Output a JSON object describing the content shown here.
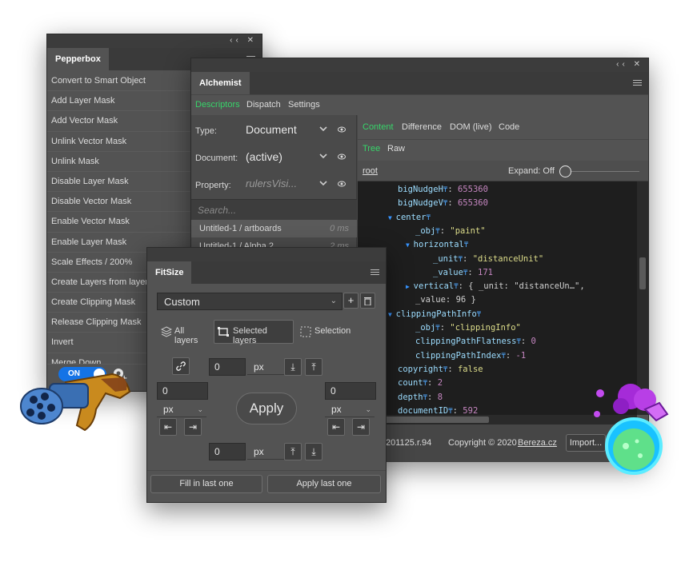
{
  "pepperbox": {
    "tab": "Pepperbox",
    "controls": "‹‹ ✕",
    "items": [
      "Convert to Smart Object",
      "Add Layer Mask",
      "Add Vector Mask",
      "Unlink Vector Mask",
      "Unlink Mask",
      "Disable Layer Mask",
      "Disable Vector Mask",
      "Enable Vector Mask",
      "Enable Layer Mask",
      "Scale Effects / 200%",
      "Create Layers from layer s",
      "Create Clipping Mask",
      "Release Clipping Mask",
      "Invert",
      "Merge Down"
    ],
    "toggle_label": "ON"
  },
  "alchemist": {
    "tab": "Alchemist",
    "controls": "‹‹ ✕",
    "top_tabs": [
      "Descriptors",
      "Dispatch",
      "Settings"
    ],
    "type_label": "Type:",
    "type_value": "Document",
    "document_label": "Document:",
    "document_value": "(active)",
    "property_label": "Property:",
    "property_value": "rulersVisi...",
    "search_placeholder": "Search...",
    "history": [
      {
        "name": "Untitled-1 / artboards",
        "ms": "0 ms"
      },
      {
        "name": "Untitled-1 / Alpha 2",
        "ms": "2 ms"
      }
    ],
    "content_tabs": [
      "Content",
      "Difference",
      "DOM (live)",
      "Code"
    ],
    "view_tabs": [
      "Tree",
      "Raw"
    ],
    "root_label": "root",
    "expand_label": "Expand: Off",
    "tree": [
      {
        "indent": 0,
        "key": "bigNudgeH",
        "value": "655360",
        "kind": "n"
      },
      {
        "indent": 0,
        "key": "bigNudgeV",
        "value": "655360",
        "kind": "n"
      },
      {
        "indent": 0,
        "key": "center",
        "value": "",
        "kind": "o",
        "open": true
      },
      {
        "indent": 1,
        "key": "_obj",
        "value": "\"paint\"",
        "kind": "s"
      },
      {
        "indent": 1,
        "key": "horizontal",
        "value": "",
        "kind": "o",
        "open": true
      },
      {
        "indent": 2,
        "key": "_unit",
        "value": "\"distanceUnit\"",
        "kind": "s"
      },
      {
        "indent": 2,
        "key": "_value",
        "value": "171",
        "kind": "n"
      },
      {
        "indent": 1,
        "key": "vertical",
        "value": "{ _unit: \"distanceUn…\",",
        "kind": "w",
        "open": false
      },
      {
        "indent": 1,
        "key": "",
        "value": "_value: 96 }",
        "kind": "w"
      },
      {
        "indent": 0,
        "key": "clippingPathInfo",
        "value": "",
        "kind": "o",
        "open": true
      },
      {
        "indent": 1,
        "key": "_obj",
        "value": "\"clippingInfo\"",
        "kind": "s"
      },
      {
        "indent": 1,
        "key": "clippingPathFlatness",
        "value": "0",
        "kind": "n"
      },
      {
        "indent": 1,
        "key": "clippingPathIndex",
        "value": "-1",
        "kind": "n"
      },
      {
        "indent": 0,
        "key": "copyright",
        "value": "false",
        "kind": "s"
      },
      {
        "indent": 0,
        "key": "count",
        "value": "2",
        "kind": "n"
      },
      {
        "indent": 0,
        "key": "depth",
        "value": "8",
        "kind": "n"
      },
      {
        "indent": 0,
        "key": "documentID",
        "value": "592",
        "kind": "n"
      }
    ],
    "version": "201125.r.94",
    "copyright_text": "Copyright © 2020",
    "author_link": "Bereza.cz",
    "import_label": "Import..."
  },
  "fitsize": {
    "tab": "FitSize",
    "preset": "Custom",
    "add_icon": "+",
    "delete_icon": "🗑",
    "modes": [
      "All layers",
      "Selected layers",
      "Selection"
    ],
    "top_value": "0",
    "top_unit": "px",
    "left_value": "0",
    "left_unit": "px",
    "right_value": "0",
    "right_unit": "px",
    "bottom_value": "0",
    "bottom_unit": "px",
    "apply_label": "Apply",
    "fill_label": "Fill in last one",
    "apply_last_label": "Apply last one"
  },
  "colors": {
    "accent_green": "#37d46a",
    "accent_blue": "#1473e6",
    "panel_bg": "#535353",
    "code_bg": "#1e1e1e"
  }
}
